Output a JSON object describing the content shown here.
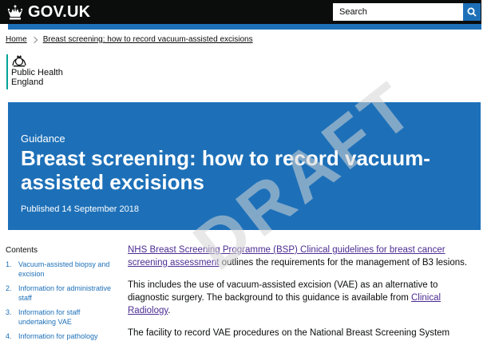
{
  "header": {
    "logo_text": "GOV.UK",
    "search_placeholder": "Search"
  },
  "breadcrumb": [
    "Home",
    "Breast screening: how to record vacuum-assisted excisions"
  ],
  "organisation": {
    "line1": "Public Health",
    "line2": "England"
  },
  "banner": {
    "type": "Guidance",
    "title": "Breast screening: how to record vacuum-assisted excisions",
    "published": "Published 14 September 2018"
  },
  "contents": {
    "heading": "Contents",
    "items": [
      {
        "num": "1.",
        "label": "Vacuum-assisted biopsy and excision"
      },
      {
        "num": "2.",
        "label": "Information for administrative staff"
      },
      {
        "num": "3.",
        "label": "Information for staff undertaking VAE"
      },
      {
        "num": "4.",
        "label": "Information for pathology"
      }
    ]
  },
  "body": {
    "p1_link": "NHS Breast Screening Programme (BSP) Clinical guidelines for breast cancer screening assessment",
    "p1_text": " outlines the requirements for the management of B3 lesions.",
    "p2_text": "This includes the use of vacuum-assisted excision (VAE) as an alternative to diagnostic surgery. The background to this guidance is available from ",
    "p2_link": "Clinical Radiology",
    "p2_end": ".",
    "p3_text": "The facility to record VAE procedures on the National Breast Screening System"
  },
  "watermark": "DRAFT",
  "colors": {
    "header_bg": "#0b0c0c",
    "brand_blue": "#1d70b8",
    "link_visited": "#4c2c92",
    "org_stripe": "#00a499"
  }
}
